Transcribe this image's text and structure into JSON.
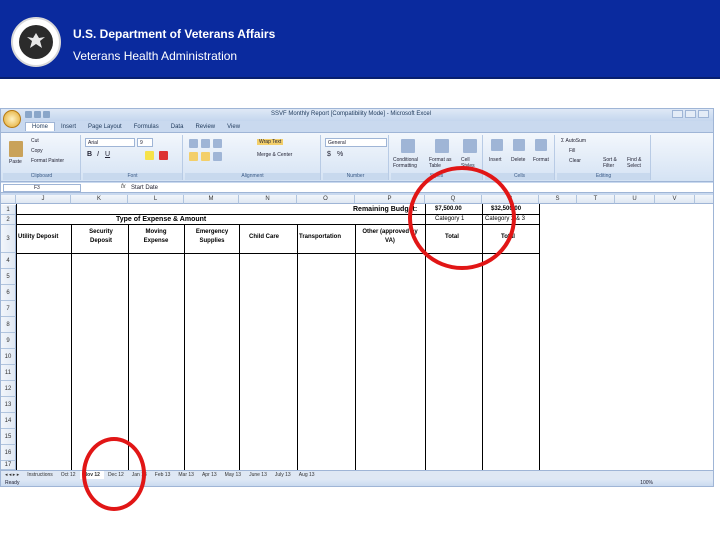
{
  "banner": {
    "title": "U.S. Department of Veterans Affairs",
    "subtitle": "Veterans Health Administration"
  },
  "excel": {
    "window_title": "SSVF Monthly Report [Compatibility Mode] - Microsoft Excel",
    "tabs": [
      "Home",
      "Insert",
      "Page Layout",
      "Formulas",
      "Data",
      "Review",
      "View"
    ],
    "ribbon": {
      "paste": "Paste",
      "cut": "Cut",
      "copy": "Copy",
      "format_painter": "Format Painter",
      "clipboard": "Clipboard",
      "font_name": "Arial",
      "font_size": "9",
      "font": "Font",
      "wrap_text": "Wrap Text",
      "merge_center": "Merge & Center",
      "alignment": "Alignment",
      "number_format": "General",
      "number": "Number",
      "conditional_formatting": "Conditional Formatting",
      "format_as_table": "Format as Table",
      "cell_styles": "Cell Styles",
      "styles": "Styles",
      "insert": "Insert",
      "delete": "Delete",
      "format": "Format",
      "cells": "Cells",
      "autosum": "AutoSum",
      "fill": "Fill",
      "clear": "Clear",
      "sort_filter": "Sort & Filter",
      "find_select": "Find & Select",
      "editing": "Editing"
    },
    "name_box": "F3",
    "formula": "Start Date",
    "columns": [
      "J",
      "K",
      "L",
      "M",
      "N",
      "O",
      "P",
      "Q",
      "R",
      "S",
      "T",
      "U",
      "V"
    ],
    "rows": [
      "1",
      "2",
      "3",
      "4",
      "5",
      "6",
      "7",
      "8",
      "9",
      "10",
      "11",
      "12",
      "13",
      "14",
      "15",
      "16",
      "17"
    ],
    "cells": {
      "remaining_budget": "Remaining Budget:",
      "budget_q": "$7,500.00",
      "budget_r": "$32,500.00",
      "type_of_expense": "Type of Expense & Amount",
      "category_1": "Category 1",
      "category_2_3": "Category 2 & 3",
      "utility_deposit": "Utility Deposit",
      "security_deposit": "Security Deposit",
      "moving_expense": "Moving Expense",
      "emergency_supplies": "Emergency Supplies",
      "child_care": "Child Care",
      "transportation": "Transportation",
      "other_approved": "Other (approved by VA)",
      "total_q": "Total",
      "total_r": "Total"
    },
    "sheet_tabs": [
      "Instructions",
      "Oct 12",
      "Nov 12",
      "Dec 12",
      "Jan 13",
      "Feb 13",
      "Mar 13",
      "Apr 13",
      "May 13",
      "June 13",
      "July 13",
      "Aug 13"
    ],
    "active_sheet": "Nov 12",
    "status": "Ready",
    "zoom": "100%"
  }
}
